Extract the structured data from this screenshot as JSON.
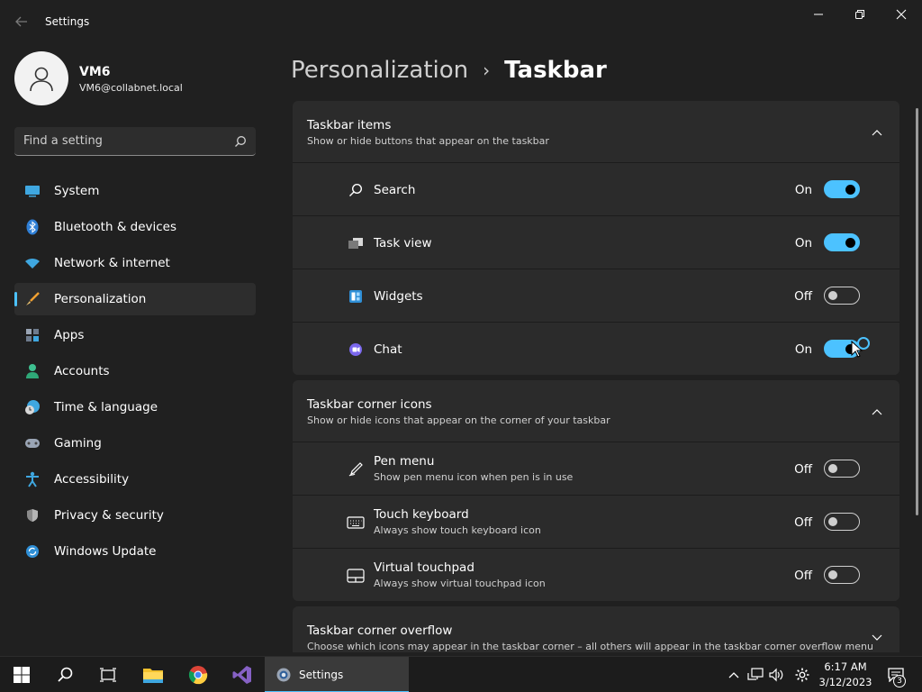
{
  "window": {
    "title": "Settings",
    "controls": [
      "minimize",
      "restore",
      "close"
    ]
  },
  "profile": {
    "name": "VM6",
    "email": "VM6@collabnet.local"
  },
  "search": {
    "placeholder": "Find a setting"
  },
  "sidebar": {
    "items": [
      {
        "label": "System",
        "icon": "system-icon"
      },
      {
        "label": "Bluetooth & devices",
        "icon": "bluetooth-icon"
      },
      {
        "label": "Network & internet",
        "icon": "wifi-icon"
      },
      {
        "label": "Personalization",
        "icon": "brush-icon",
        "active": true
      },
      {
        "label": "Apps",
        "icon": "apps-icon"
      },
      {
        "label": "Accounts",
        "icon": "accounts-icon"
      },
      {
        "label": "Time & language",
        "icon": "clock-globe-icon"
      },
      {
        "label": "Gaming",
        "icon": "gamepad-icon"
      },
      {
        "label": "Accessibility",
        "icon": "accessibility-icon"
      },
      {
        "label": "Privacy & security",
        "icon": "shield-icon"
      },
      {
        "label": "Windows Update",
        "icon": "update-icon"
      }
    ]
  },
  "breadcrumb": {
    "parent": "Personalization",
    "separator": "›",
    "current": "Taskbar"
  },
  "groups": {
    "taskbar_items": {
      "title": "Taskbar items",
      "desc": "Show or hide buttons that appear on the taskbar",
      "expanded": true,
      "rows": [
        {
          "label": "Search",
          "state": "On",
          "on": true,
          "icon": "search-icon"
        },
        {
          "label": "Task view",
          "state": "On",
          "on": true,
          "icon": "task-view-icon"
        },
        {
          "label": "Widgets",
          "state": "Off",
          "on": false,
          "icon": "widgets-icon"
        },
        {
          "label": "Chat",
          "state": "On",
          "on": true,
          "icon": "chat-icon"
        }
      ]
    },
    "corner_icons": {
      "title": "Taskbar corner icons",
      "desc": "Show or hide icons that appear on the corner of your taskbar",
      "expanded": true,
      "rows": [
        {
          "label": "Pen menu",
          "desc": "Show pen menu icon when pen is in use",
          "state": "Off",
          "on": false,
          "icon": "pen-icon"
        },
        {
          "label": "Touch keyboard",
          "desc": "Always show touch keyboard icon",
          "state": "Off",
          "on": false,
          "icon": "keyboard-icon"
        },
        {
          "label": "Virtual touchpad",
          "desc": "Always show virtual touchpad icon",
          "state": "Off",
          "on": false,
          "icon": "touchpad-icon"
        }
      ]
    },
    "corner_overflow": {
      "title": "Taskbar corner overflow",
      "desc": "Choose which icons may appear in the taskbar corner – all others will appear in the taskbar corner overflow menu",
      "expanded": false
    }
  },
  "taskbar": {
    "active_app_label": "Settings",
    "time": "6:17 AM",
    "date": "3/12/2023",
    "notification_count": "3",
    "accent": "#4cc2ff"
  }
}
